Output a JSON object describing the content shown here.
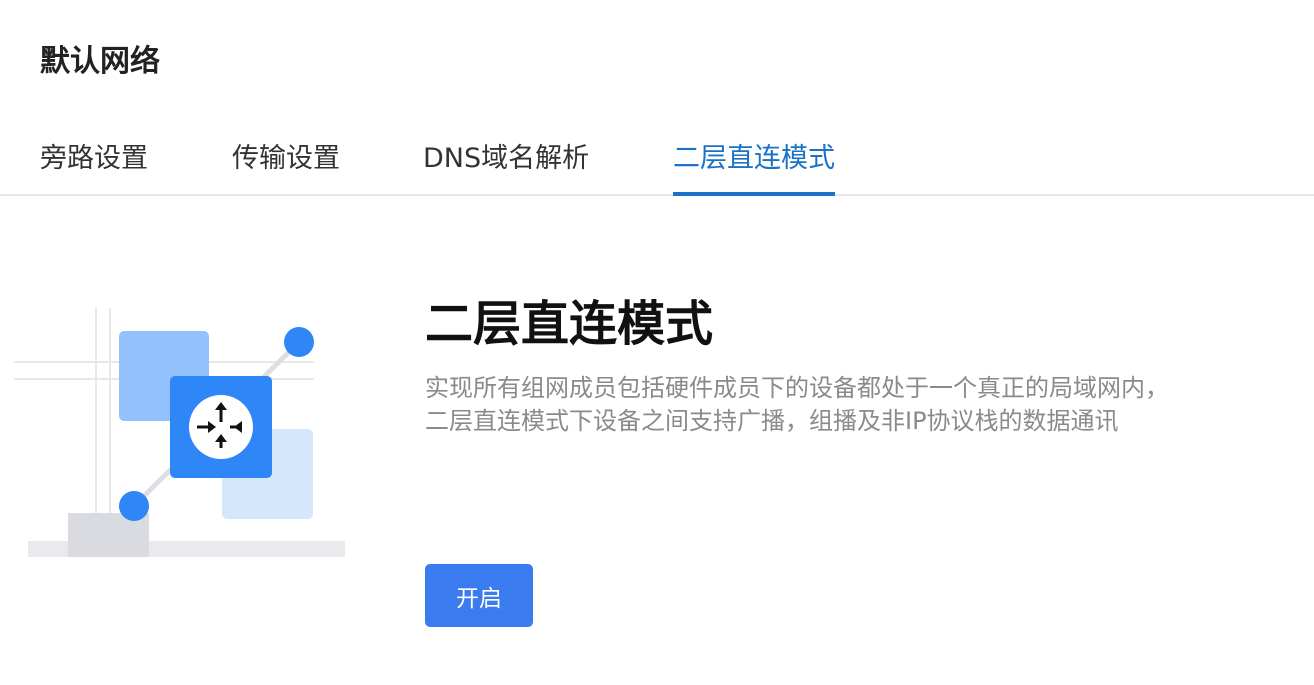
{
  "header": {
    "title": "默认网络"
  },
  "tabs": [
    {
      "label": "旁路设置",
      "active": false
    },
    {
      "label": "传输设置",
      "active": false
    },
    {
      "label": "DNS域名解析",
      "active": false
    },
    {
      "label": "二层直连模式",
      "active": true
    }
  ],
  "feature": {
    "title": "二层直连模式",
    "description_line1": "实现所有组网成员包括硬件成员下的设备都处于一个真正的局域网内，",
    "description_line2": "二层直连模式下设备之间支持广播，组播及非IP协议栈的数据通讯",
    "illustration_icon": "router-icon",
    "enable_label": "开启"
  },
  "colors": {
    "accent": "#1a73c8",
    "button": "#3a7bf0",
    "illustration_blue": "#2f86f6",
    "illustration_light": "#93c1fb",
    "illustration_pale": "#d4e7fd"
  }
}
